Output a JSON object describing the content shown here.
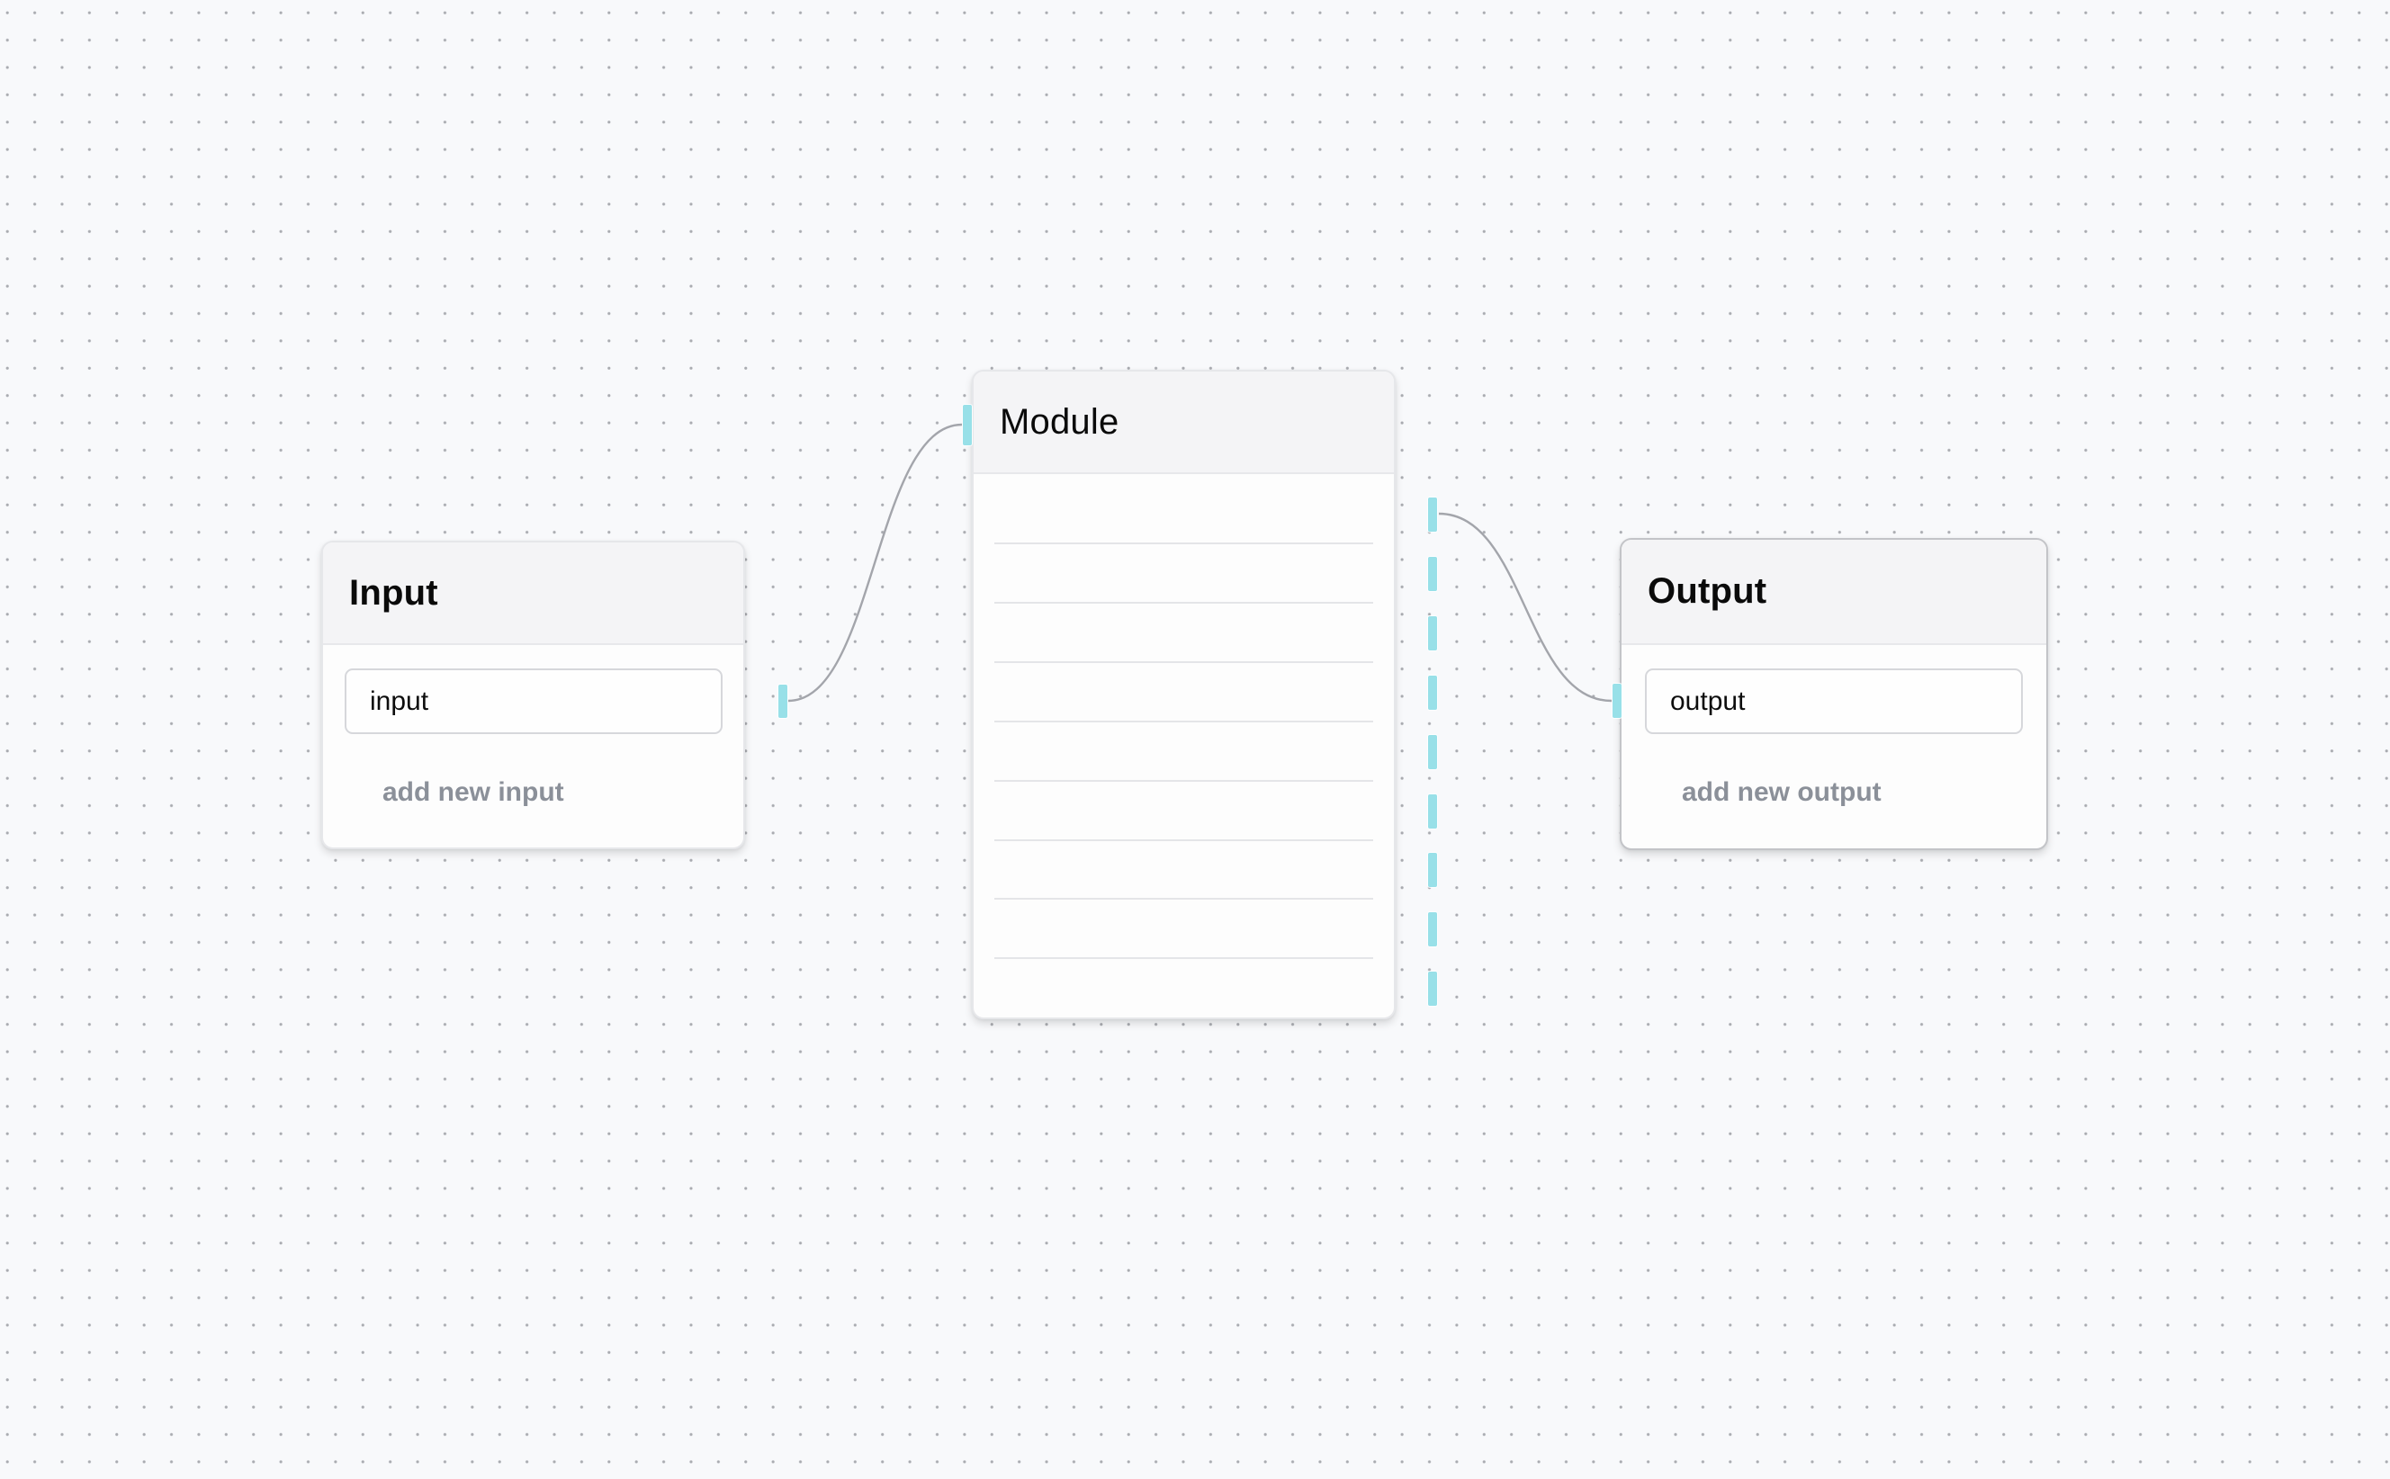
{
  "canvas": {
    "background": "#f8f9fb",
    "grid": "dots"
  },
  "colors": {
    "port": "#98e0e8",
    "edge": "#a3a5ab",
    "header_bg": "#f4f4f6",
    "add_link_text": "#8b9099"
  },
  "nodes": {
    "input": {
      "title": "Input",
      "fields": [
        {
          "value": "input"
        }
      ],
      "add_label": "add new input",
      "selected": false
    },
    "module": {
      "title": "Module",
      "rows": 9,
      "output_ports": 9,
      "input_ports": 1
    },
    "output": {
      "title": "Output",
      "fields": [
        {
          "value": "output"
        }
      ],
      "add_label": "add new output",
      "selected": true
    }
  },
  "edges": [
    {
      "from": "input.input",
      "to": "module.in"
    },
    {
      "from": "module.out-1",
      "to": "output.output"
    }
  ]
}
